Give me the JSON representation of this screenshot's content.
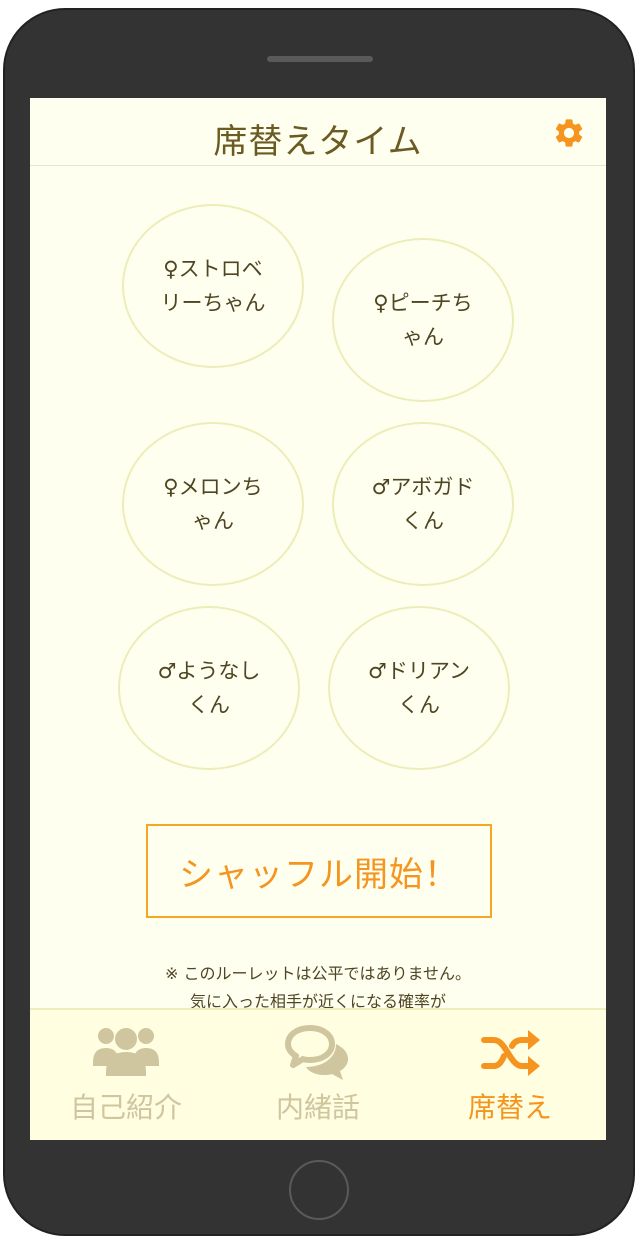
{
  "header": {
    "title": "席替えタイム",
    "settings_icon": "gear-icon"
  },
  "seats": [
    {
      "label": "♀ストロベリーちゃん"
    },
    {
      "label": "♀ピーチちゃん"
    },
    {
      "label": "♀メロンちゃん"
    },
    {
      "label": "♂アボガドくん"
    },
    {
      "label": "♂ようなしくん"
    },
    {
      "label": "♂ドリアンくん"
    }
  ],
  "shuffle_button": {
    "label": "シャッフル開始！"
  },
  "note": {
    "line1": "※ このルーレットは公平ではありません。",
    "line2": "気に入った相手が近くになる確率が"
  },
  "tabs": [
    {
      "label": "自己紹介",
      "icon": "users-icon",
      "active": false
    },
    {
      "label": "内緒話",
      "icon": "chat-bubbles-icon",
      "active": false
    },
    {
      "label": "席替え",
      "icon": "shuffle-icon",
      "active": true
    }
  ],
  "colors": {
    "accent": "#f5951f",
    "background": "#fffff0",
    "tabbar_background": "#fffee0",
    "inactive_tab": "#cfc6a0",
    "title_text": "#6b5a22",
    "seat_border": "#ecedb8"
  }
}
